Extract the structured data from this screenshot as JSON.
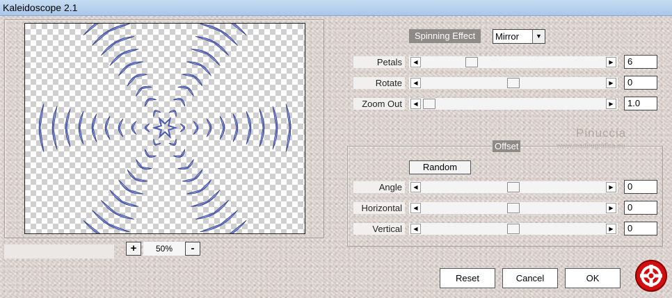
{
  "window": {
    "title": "Kaleidoscope 2.1"
  },
  "preview": {
    "zoom": "50%",
    "zoom_in_label": "+",
    "zoom_out_label": "-",
    "pattern_color": "#4a5ab0"
  },
  "spinning": {
    "label": "Spinning Effect",
    "mode": "Mirror"
  },
  "controls": [
    {
      "label": "Petals",
      "value": "6",
      "level": 0.25
    },
    {
      "label": "Rotate",
      "value": "0",
      "level": 0.5
    },
    {
      "label": "Zoom Out",
      "value": "1.0",
      "level": 0.0
    }
  ],
  "offset": {
    "title": "Offset",
    "random_label": "Random",
    "controls": [
      {
        "label": "Angle",
        "value": "0",
        "level": 0.5
      },
      {
        "label": "Horizontal",
        "value": "0",
        "level": 0.5
      },
      {
        "label": "Vertical",
        "value": "0",
        "level": 0.5
      }
    ]
  },
  "watermark": {
    "name": "Pinuccia",
    "url": "www.madiregrafica.eu"
  },
  "buttons": {
    "reset": "Reset",
    "cancel": "Cancel",
    "ok": "OK"
  },
  "colors": {
    "accent_logo": "#d10f10",
    "label_bg": "#8e8a87"
  },
  "icons": {
    "logo": "help-lifebuoy-icon",
    "dropdown": "chevron-down-icon"
  }
}
